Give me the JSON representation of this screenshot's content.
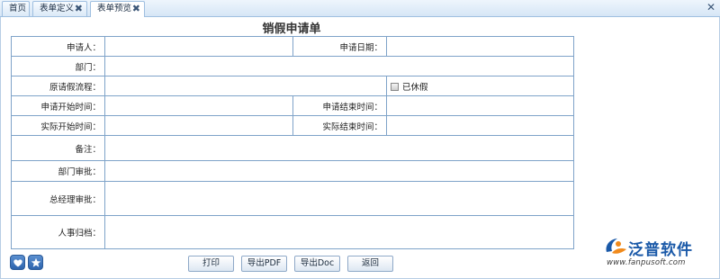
{
  "tabs": [
    {
      "label": "首页",
      "closable": false
    },
    {
      "label": "表单定义",
      "closable": true
    },
    {
      "label": "表单预览",
      "closable": true,
      "active": true
    }
  ],
  "tab_close_glyph": "✖",
  "window_close_glyph": "✕",
  "form": {
    "title": "销假申请单",
    "fields": {
      "applicant": "申请人：",
      "apply_date": "申请日期：",
      "department": "部门：",
      "original_leave_flow": "原请假流程：",
      "rested_checkbox": "已休假",
      "apply_start": "申请开始时间：",
      "apply_end": "申请结束时间：",
      "actual_start": "实际开始时间：",
      "actual_end": "实际结束时间：",
      "remarks": "备注：",
      "dept_approval": "部门审批：",
      "gm_approval": "总经理审批：",
      "hr_archive": "人事归档："
    },
    "rested_checked": false
  },
  "buttons": {
    "print": "打印",
    "export_pdf": "导出PDF",
    "export_doc": "导出Doc",
    "back": "返回"
  },
  "corner_icons": [
    "heart-icon",
    "star-icon"
  ],
  "logo": {
    "name": "泛普软件",
    "url": "www.fanpusoft.com"
  },
  "colors": {
    "table_border": "#7fa3c9",
    "tab_bar": "#d6e6f6",
    "logo_blue": "#1a59a8",
    "logo_orange": "#f08a1c"
  }
}
